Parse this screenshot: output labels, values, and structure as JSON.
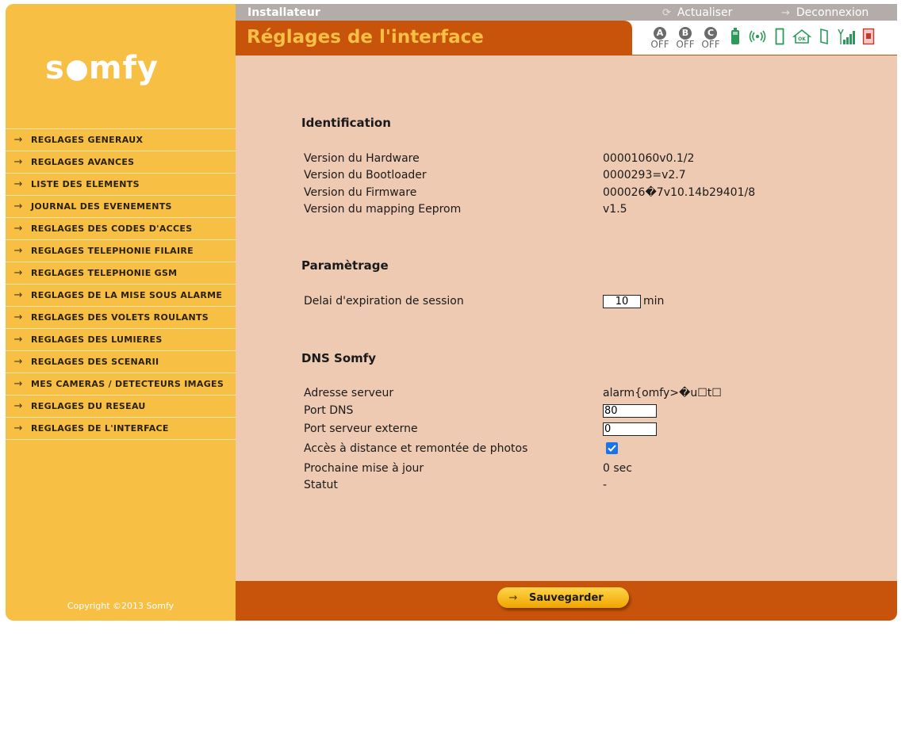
{
  "brand": {
    "logo_text": "somfy"
  },
  "topbar": {
    "role": "Installateur",
    "refresh_label": "Actualiser",
    "logout_label": "Deconnexion"
  },
  "header": {
    "title": "Réglages de l'interface"
  },
  "status": {
    "zones": [
      {
        "letter": "A",
        "state": "OFF"
      },
      {
        "letter": "B",
        "state": "OFF"
      },
      {
        "letter": "C",
        "state": "OFF"
      }
    ],
    "icons": [
      "battery-icon",
      "radio-signal-icon",
      "door-icon",
      "house-ok-icon",
      "tamper-icon",
      "gsm-signal-icon",
      "sim-card-icon"
    ]
  },
  "sidebar": {
    "items": [
      {
        "label": "REGLAGES GENERAUX"
      },
      {
        "label": "REGLAGES AVANCES"
      },
      {
        "label": "LISTE DES ELEMENTS"
      },
      {
        "label": "JOURNAL DES EVENEMENTS"
      },
      {
        "label": "REGLAGES DES CODES D'ACCES"
      },
      {
        "label": "REGLAGES TELEPHONIE FILAIRE"
      },
      {
        "label": "REGLAGES TELEPHONIE GSM"
      },
      {
        "label": "REGLAGES DE LA MISE SOUS ALARME"
      },
      {
        "label": "REGLAGES DES VOLETS ROULANTS"
      },
      {
        "label": "REGLAGES DES LUMIERES"
      },
      {
        "label": "REGLAGES DES SCENARII"
      },
      {
        "label": "MES CAMERAS / DETECTEURS IMAGES"
      },
      {
        "label": "REGLAGES DU RESEAU"
      },
      {
        "label": "REGLAGES DE L'INTERFACE"
      }
    ],
    "copyright": "Copyright ©2013 Somfy"
  },
  "identification": {
    "title": "Identification",
    "rows": [
      {
        "label": "Version du Hardware",
        "value": "00001060v0.1/2"
      },
      {
        "label": "Version du Bootloader",
        "value": "0000293=v2.7"
      },
      {
        "label": "Version du Firmware",
        "value": "000026�7v10.14b29401/8"
      },
      {
        "label": "Version du mapping Eeprom",
        "value": "v1.5"
      }
    ]
  },
  "parametrage": {
    "title": "Paramètrage",
    "session_label": "Delai d'expiration de session",
    "session_value": "10",
    "session_unit": "min"
  },
  "dns": {
    "title": "DNS Somfy",
    "server_label": "Adresse serveur",
    "server_value": "alarm{omfy>�u☐t☐",
    "dns_port_label": "Port DNS",
    "dns_port_value": "80",
    "ext_port_label": "Port serveur externe",
    "ext_port_value": "0",
    "remote_label": "Accès à distance et remontée de photos",
    "remote_checked": true,
    "next_update_label": "Prochaine mise à jour",
    "next_update_value": "0 sec",
    "status_label": "Statut",
    "status_value": "-"
  },
  "footer": {
    "save_label": "Sauvegarder"
  },
  "colors": {
    "sidebar": "#f8bf45",
    "accent": "#c8530a",
    "content_bg": "#eecab2",
    "topbar": "#b3aca8",
    "icon_green": "#2e9a5a"
  }
}
